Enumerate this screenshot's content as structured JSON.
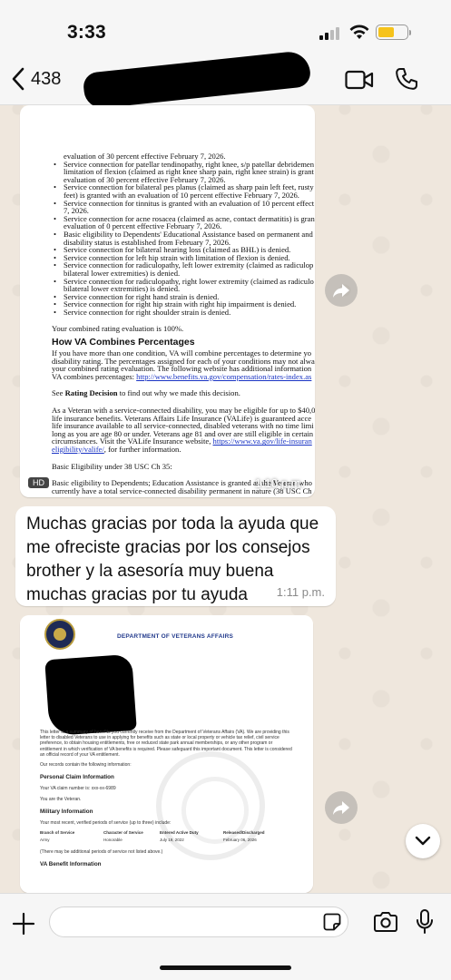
{
  "status_bar": {
    "time": "3:33",
    "battery_color": "#f6c31b"
  },
  "header": {
    "back_count": "438"
  },
  "messages": {
    "image1": {
      "hd_badge": "HD",
      "time": "1:10 p.m.",
      "lines": [
        {
          "type": "plain",
          "text": "evaluation of 30 percent effective February 7, 2026."
        },
        {
          "type": "bullet",
          "text": "Service connection for patellar tendinopathy, right knee, s/p patellar debridemen"
        },
        {
          "type": "plain",
          "text": "limitation of flexion (claimed as right knee sharp pain, right knee strain) is grant"
        },
        {
          "type": "plain",
          "text": "evaluation of 30 percent effective February 7, 2026."
        },
        {
          "type": "bullet",
          "text": "Service connection for bilateral pes planus (claimed as sharp pain left feet, rusty"
        },
        {
          "type": "plain",
          "text": "feet) is granted with an evaluation of 10 percent effective February 7, 2026."
        },
        {
          "type": "bullet",
          "text": "Service connection for tinnitus is granted with an evaluation of 10 percent effect"
        },
        {
          "type": "plain",
          "text": "7, 2026."
        },
        {
          "type": "bullet",
          "text": "Service connection for acne rosacea (claimed as acne, contact dermatitis) is gran"
        },
        {
          "type": "plain",
          "text": "evaluation of 0 percent effective February 7, 2026."
        },
        {
          "type": "bullet",
          "text": "Basic eligibility to Dependents' Educational Assistance based on permanent and"
        },
        {
          "type": "plain",
          "text": "disability status is established from February 7, 2026."
        },
        {
          "type": "bullet",
          "text": "Service connection for bilateral hearing loss (claimed as BHL) is denied."
        },
        {
          "type": "bullet",
          "text": "Service connection for left hip strain with limitation of flexion is denied."
        },
        {
          "type": "bullet",
          "text": "Service connection for radiculopathy, left lower extremity (claimed as radiculop"
        },
        {
          "type": "plain",
          "text": "bilateral lower extremities) is denied."
        },
        {
          "type": "bullet",
          "text": "Service connection for radiculopathy, right lower extremity (claimed as radiculo"
        },
        {
          "type": "plain",
          "text": "bilateral lower extremities) is denied."
        },
        {
          "type": "bullet",
          "text": "Service connection for right hand strain is denied."
        },
        {
          "type": "bullet",
          "text": "Service connection for right hip strain with right hip impairment is denied."
        },
        {
          "type": "bullet",
          "text": "Service connection for right shoulder strain is denied."
        }
      ],
      "combined": "Your combined rating evaluation is 100%.",
      "section_title": "How VA Combines Percentages",
      "para1": [
        "If you have more than one condition, VA will combine percentages to determine yo",
        "disability rating. The percentages assigned for each of your conditions may not alwa",
        "your combined rating evaluation. The following website has additional information"
      ],
      "para1_link_prefix": "VA combines percentages: ",
      "para1_link": "http://www.benefits.va.gov/compensation/rates-index.as",
      "see_prefix": "See ",
      "see_bold": "Rating Decision",
      "see_suffix": " to find out why we made this decision.",
      "para2": [
        "As a Veteran with a service-connected disability, you may be eligible for up to $40,0",
        "life insurance benefits. Veterans Affairs Life Insurance (VALife) is guaranteed acce",
        "life insurance available to all service-connected, disabled veterans with no time limi",
        "long as you are age 80 or under. Veterans age 81 and over are still eligible in certain"
      ],
      "para2_link_prefix": "circumstances. Visit the VALife Insurance website, ",
      "para2_link1": "https://www.va.gov/life-insuran",
      "para2_link2": "eligibility/valife/",
      "para2_suffix": ", for further information.",
      "basic_elig": "Basic Eligibility under 38 USC Ch 35:",
      "last_lines": [
        "Basic eligibility to Dependents; Education Assistance is granted as the Veteran who",
        "currently have a total service-connected disability permanent in nature (38 USC Ch"
      ]
    },
    "text1": {
      "text": "Muchas gracias por toda la ayuda que me ofreciste gracias por los consejos brother y la asesoría muy buena muchas gracias por tu ayuda",
      "time": "1:11 p.m."
    },
    "image2": {
      "department": "DEPARTMENT OF VETERANS AFFAIRS",
      "intro": "This letter is a summary of benefits you currently receive from the Department of Veterans Affairs (VA). We are providing this letter to disabled Veterans to use in applying for benefits such as state or local property or vehicle tax relief, civil service preference, to obtain housing entitlements, free or reduced state park annual memberships, or any other program or entitlement in which verification of VA benefits is required. Please safeguard this important document. This letter is considered an official record of your VA entitlement.",
      "records": "Our records contain the following information:",
      "personal_title": "Personal Claim Information",
      "claim_number": "Your VA claim number is: xxx-xx-6989",
      "you_are": "You are the Veteran.",
      "military_title": "Military Information",
      "military_intro": "Your most recent, verified periods of service (up to three) include:",
      "table_headers": [
        "Branch of Service",
        "Character of Service",
        "Entered Active Duty",
        "Released/Discharged"
      ],
      "table_row": [
        "Army",
        "Honorable",
        "July 19, 2022",
        "February 06, 2026"
      ],
      "more_periods": "(There may be additional periods of service not listed above.)",
      "benefit_title": "VA Benefit Information"
    }
  },
  "input": {
    "placeholder": ""
  }
}
